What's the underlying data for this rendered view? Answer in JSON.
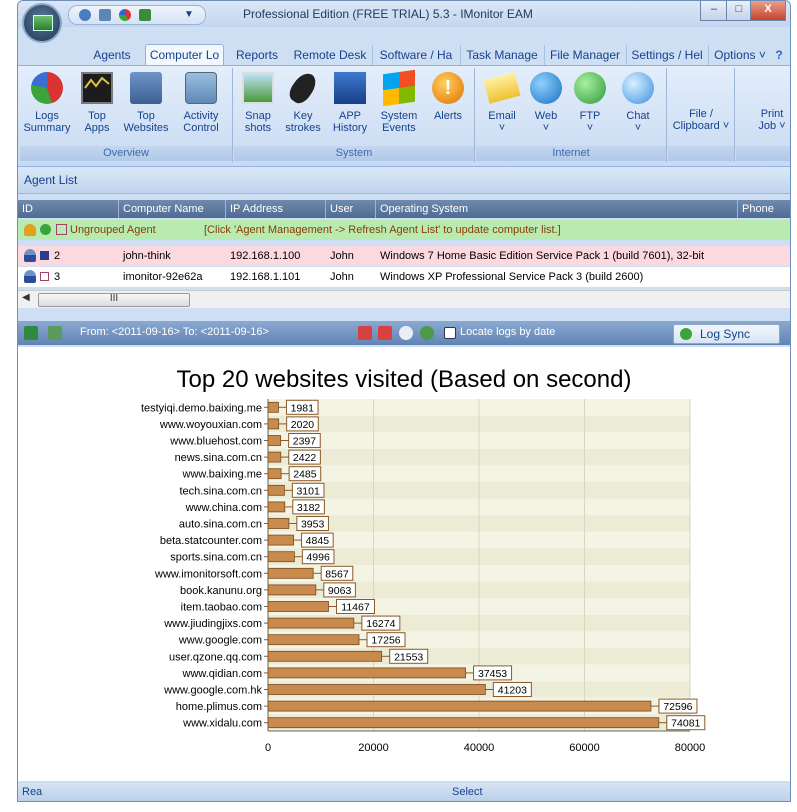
{
  "window": {
    "title": "Professional Edition (FREE TRIAL) 5.3 - IMonitor EAM",
    "min_label": "–",
    "max_label": "□",
    "close_label": "X"
  },
  "tabs": [
    {
      "label": "Agents",
      "active": false
    },
    {
      "label": "Computer Lo",
      "active": true
    },
    {
      "label": "Reports",
      "active": false
    },
    {
      "label": "Remote Desk",
      "active": false
    },
    {
      "label": "Software / Ha",
      "active": false
    },
    {
      "label": "Task Manage",
      "active": false
    },
    {
      "label": "File Manager",
      "active": false
    },
    {
      "label": "Settings / Hel",
      "active": false
    },
    {
      "label": "Options ˅",
      "active": false
    }
  ],
  "ribbon": {
    "groups": [
      {
        "title": "Overview",
        "buttons": [
          {
            "line1": "Logs",
            "line2": "Summary",
            "icon": "pie-chart-icon"
          },
          {
            "line1": "Top",
            "line2": "Apps",
            "icon": "monitor-graph-icon"
          },
          {
            "line1": "Top",
            "line2": "Websites",
            "icon": "web-gear-icon"
          },
          {
            "line1": "Activity",
            "line2": "Control",
            "icon": "activity-monitor-icon"
          }
        ]
      },
      {
        "title": "System",
        "buttons": [
          {
            "line1": "Snap",
            "line2": "shots",
            "icon": "snapshot-icon"
          },
          {
            "line1": "Key",
            "line2": "strokes",
            "icon": "mouse-icon"
          },
          {
            "line1": "APP",
            "line2": "History",
            "icon": "app-window-icon"
          },
          {
            "line1": "System",
            "line2": "Events",
            "icon": "windows-logo-icon"
          },
          {
            "line1": "Alerts",
            "line2": "",
            "icon": "alert-icon"
          }
        ]
      },
      {
        "title": "Internet",
        "buttons": [
          {
            "line1": "Email",
            "line2": "˅",
            "icon": "envelope-icon"
          },
          {
            "line1": "Web",
            "line2": "˅",
            "icon": "globe-icon"
          },
          {
            "line1": "FTP",
            "line2": "˅",
            "icon": "ftp-globe-icon"
          },
          {
            "line1": "Chat",
            "line2": "˅",
            "icon": "chat-bubble-icon"
          }
        ]
      },
      {
        "title": "",
        "buttons": [
          {
            "line1": "File /",
            "line2": "Clipboard ˅",
            "icon": ""
          }
        ]
      },
      {
        "title": "",
        "buttons": [
          {
            "line1": "Print",
            "line2": "Job ˅",
            "icon": ""
          }
        ]
      }
    ]
  },
  "agent_list": {
    "title": "Agent List",
    "columns": [
      "ID",
      "Computer Name",
      "IP Address",
      "User",
      "Operating System",
      "Phone"
    ],
    "group_row": {
      "label": "Ungrouped Agent",
      "hint": "[Click 'Agent Management -> Refresh Agent List' to update computer list.]"
    },
    "rows": [
      {
        "id": "2",
        "name": "john-think",
        "ip": "192.168.1.100",
        "user": "John",
        "os": "Windows 7 Home Basic Edition Service Pack 1 (build 7601), 32-bit"
      },
      {
        "id": "3",
        "name": "imonitor-92e62a",
        "ip": "192.168.1.101",
        "user": "John",
        "os": "Windows XP Professional Service Pack 3 (build 2600)"
      }
    ],
    "scroll_thumb": "III"
  },
  "log_toolbar": {
    "date_range": "From: <2011-09-16> To: <2011-09-16>",
    "locate_label": "Locate logs by date",
    "sync_label": "Log Sync"
  },
  "status": {
    "left": "Rea",
    "middle": "Select"
  },
  "colors": {
    "bar": "#c98a4e",
    "bar_edge": "#7a4a1c",
    "label_border": "#8a5a2a",
    "plot_band_a": "#f4f4e4",
    "plot_band_b": "#ebebd6"
  },
  "chart_data": {
    "type": "bar",
    "orientation": "horizontal",
    "title": "Top 20 websites visited (Based on second)",
    "categories": [
      "testyiqi.demo.baixing.me",
      "www.woyouxian.com",
      "www.bluehost.com",
      "news.sina.com.cn",
      "www.baixing.me",
      "tech.sina.com.cn",
      "www.china.com",
      "auto.sina.com.cn",
      "beta.statcounter.com",
      "sports.sina.com.cn",
      "www.imonitorsoft.com",
      "book.kanunu.org",
      "item.taobao.com",
      "www.jiudingjixs.com",
      "www.google.com",
      "user.qzone.qq.com",
      "www.qidian.com",
      "www.google.com.hk",
      "home.plimus.com",
      "www.xidalu.com"
    ],
    "values": [
      1981,
      2020,
      2397,
      2422,
      2485,
      3101,
      3182,
      3953,
      4845,
      4996,
      8567,
      9063,
      11467,
      16274,
      17256,
      21553,
      37453,
      41203,
      72596,
      74081
    ],
    "xlim": [
      0,
      80000
    ],
    "xticks": [
      "0",
      "20000",
      "40000",
      "60000",
      "80000"
    ],
    "xlabel": "",
    "ylabel": "",
    "grid": true
  }
}
